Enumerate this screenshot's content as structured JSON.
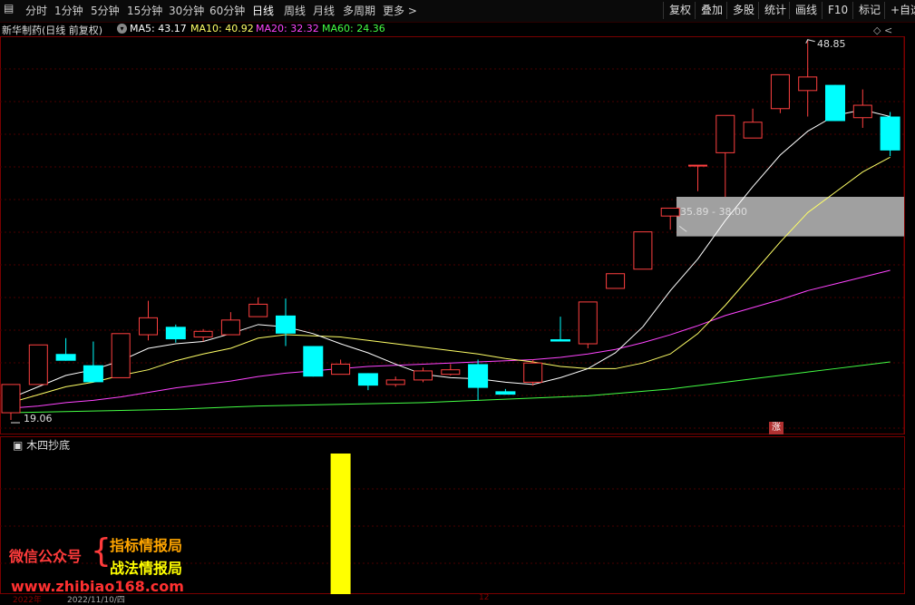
{
  "toolbar": {
    "periods": [
      "分时",
      "1分钟",
      "5分钟",
      "15分钟",
      "30分钟",
      "60分钟",
      "日线",
      "周线",
      "月线",
      "多周期",
      "更多 >"
    ],
    "active_period": "日线",
    "right_buttons": [
      "复权",
      "叠加",
      "多股",
      "统计",
      "画线",
      "F10",
      "标记",
      "+自选"
    ]
  },
  "info": {
    "stock": "新华制药(日线 前复权)",
    "ma5": "MA5: 43.17",
    "ma10": "MA10: 40.92",
    "ma20": "MA20: 32.32",
    "ma60": "MA60: 24.36",
    "colors": {
      "ma5": "#ffffff",
      "ma10": "#ffff66",
      "ma20": "#ff44ff",
      "ma60": "#44ff44"
    }
  },
  "chart_data": {
    "type": "candlestick",
    "high_marker": "48.85",
    "low_marker": "19.06",
    "zone_label": "35.89 - 38.00",
    "ohlc": [
      {
        "o": 19.7,
        "c": 22.2,
        "h": 22.2,
        "l": 19.06
      },
      {
        "o": 22.2,
        "c": 25.7,
        "h": 25.7,
        "l": 22.2
      },
      {
        "o": 24.9,
        "c": 24.3,
        "h": 26.3,
        "l": 24.3
      },
      {
        "o": 23.9,
        "c": 22.4,
        "h": 26.0,
        "l": 22.4
      },
      {
        "o": 22.8,
        "c": 26.7,
        "h": 26.7,
        "l": 22.8
      },
      {
        "o": 26.6,
        "c": 28.1,
        "h": 29.6,
        "l": 26.1
      },
      {
        "o": 27.3,
        "c": 26.2,
        "h": 27.5,
        "l": 25.9
      },
      {
        "o": 26.4,
        "c": 26.9,
        "h": 27.1,
        "l": 26.0
      },
      {
        "o": 26.6,
        "c": 27.9,
        "h": 28.6,
        "l": 26.6
      },
      {
        "o": 28.2,
        "c": 29.3,
        "h": 29.9,
        "l": 28.2
      },
      {
        "o": 28.3,
        "c": 26.7,
        "h": 29.8,
        "l": 25.6
      },
      {
        "o": 25.6,
        "c": 22.9,
        "h": 25.6,
        "l": 22.9
      },
      {
        "o": 23.1,
        "c": 24.0,
        "h": 24.4,
        "l": 23.1
      },
      {
        "o": 23.2,
        "c": 22.1,
        "h": 23.2,
        "l": 21.7
      },
      {
        "o": 22.2,
        "c": 22.6,
        "h": 22.9,
        "l": 22.0
      },
      {
        "o": 22.6,
        "c": 23.4,
        "h": 23.7,
        "l": 22.4
      },
      {
        "o": 23.1,
        "c": 23.5,
        "h": 24.0,
        "l": 23.0
      },
      {
        "o": 24.0,
        "c": 21.9,
        "h": 24.4,
        "l": 20.8
      },
      {
        "o": 21.6,
        "c": 21.3,
        "h": 21.8,
        "l": 21.3
      },
      {
        "o": 22.4,
        "c": 24.1,
        "h": 24.4,
        "l": 22.1
      },
      {
        "o": 26.2,
        "c": 26.0,
        "h": 28.2,
        "l": 26.0
      },
      {
        "o": 25.8,
        "c": 29.5,
        "h": 29.5,
        "l": 25.4
      },
      {
        "o": 30.7,
        "c": 32.0,
        "h": 32.0,
        "l": 30.7
      },
      {
        "o": 32.4,
        "c": 35.7,
        "h": 35.7,
        "l": 32.4
      },
      {
        "o": 37.1,
        "c": 37.8,
        "h": 37.8,
        "l": 35.89
      },
      {
        "o": 41.6,
        "c": 41.6,
        "h": 41.6,
        "l": 39.3
      },
      {
        "o": 42.7,
        "c": 46.0,
        "h": 46.0,
        "l": 38.8
      },
      {
        "o": 44.0,
        "c": 45.4,
        "h": 46.6,
        "l": 44.0
      },
      {
        "o": 46.6,
        "c": 49.6,
        "h": 49.6,
        "l": 46.2
      },
      {
        "o": 48.2,
        "c": 49.4,
        "h": 52.7,
        "l": 45.9
      },
      {
        "o": 48.7,
        "c": 45.5,
        "h": 48.7,
        "l": 45.5
      },
      {
        "o": 45.8,
        "c": 46.9,
        "h": 48.3,
        "l": 44.9
      },
      {
        "o": 45.9,
        "c": 42.9,
        "h": 46.3,
        "l": 42.4
      }
    ],
    "ma5": [
      21.0,
      22.0,
      23.0,
      23.5,
      24.3,
      25.4,
      25.8,
      26.0,
      26.7,
      27.5,
      27.3,
      26.7,
      25.8,
      25.0,
      24.0,
      23.1,
      22.8,
      22.7,
      22.4,
      22.2,
      22.8,
      23.6,
      25.0,
      27.3,
      30.5,
      33.3,
      36.7,
      39.7,
      42.5,
      44.6,
      46.0,
      46.5,
      45.9
    ],
    "ma10": [
      20.6,
      21.3,
      22.0,
      22.4,
      23.0,
      23.5,
      24.3,
      24.9,
      25.4,
      26.3,
      26.6,
      26.5,
      26.4,
      26.1,
      25.8,
      25.5,
      25.2,
      24.9,
      24.5,
      24.2,
      23.8,
      23.6,
      23.6,
      24.1,
      24.9,
      26.7,
      29.2,
      32.0,
      34.8,
      37.4,
      39.2,
      41.0,
      42.3
    ],
    "ma20": [
      20.1,
      20.3,
      20.6,
      20.8,
      21.1,
      21.5,
      21.9,
      22.2,
      22.5,
      22.9,
      23.2,
      23.4,
      23.6,
      23.8,
      23.9,
      24.0,
      24.1,
      24.2,
      24.3,
      24.4,
      24.6,
      24.9,
      25.3,
      25.9,
      26.6,
      27.4,
      28.3,
      29.0,
      29.7,
      30.5,
      31.1,
      31.7,
      32.3
    ],
    "ma60": [
      19.7,
      19.75,
      19.8,
      19.85,
      19.9,
      19.95,
      20.0,
      20.1,
      20.2,
      20.3,
      20.35,
      20.4,
      20.45,
      20.5,
      20.55,
      20.6,
      20.7,
      20.8,
      20.9,
      21.0,
      21.1,
      21.2,
      21.4,
      21.6,
      21.8,
      22.1,
      22.4,
      22.7,
      23.0,
      23.3,
      23.6,
      23.9,
      24.2
    ],
    "ylim": [
      18.5,
      53.0
    ]
  },
  "indicator": {
    "title": "木四抄底",
    "bar_index": 12,
    "bar_color": "#ffff00"
  },
  "watermark": {
    "wechat": "微信公众号",
    "brand1": "指标情报局",
    "brand2": "战法情报局",
    "site": "www.zhibiao168.com"
  },
  "bottom_axis": {
    "year": "2022年",
    "date": "2022/11/10/四",
    "mark": "12"
  },
  "badge": "涨"
}
